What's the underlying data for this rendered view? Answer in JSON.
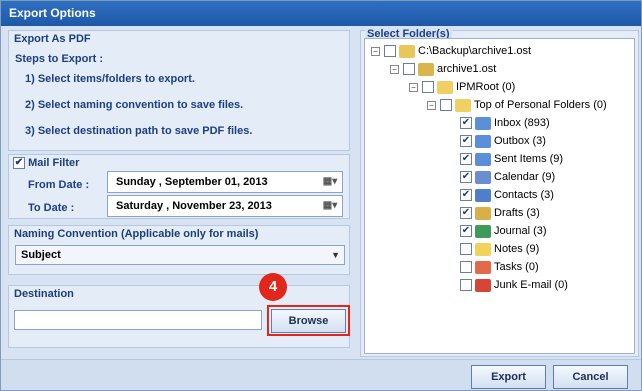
{
  "window": {
    "title": "Export Options"
  },
  "export_pdf": {
    "header": "Export As PDF",
    "steps_heading": "Steps to Export :",
    "steps": [
      "1) Select items/folders to export.",
      "2) Select naming convention to save files.",
      "3) Select destination path to save PDF files."
    ]
  },
  "mail_filter": {
    "label": "Mail Filter",
    "checked": true,
    "from_label": "From Date :",
    "from_value": "Sunday   , September 01, 2013",
    "to_label": "To Date :",
    "to_value": "Saturday  , November 23, 2013"
  },
  "naming": {
    "header": "Naming Convention (Applicable only for mails)",
    "selected": "Subject"
  },
  "destination": {
    "header": "Destination",
    "path_value": "",
    "browse_label": "Browse",
    "step_badge": "4"
  },
  "folders": {
    "header": "Select Folder(s)",
    "items": [
      {
        "label": "C:\\Backup\\archive1.ost",
        "checked": false,
        "icon": "folder-open-icon",
        "color": "#e8c658"
      },
      {
        "label": "archive1.ost",
        "checked": false,
        "icon": "pst-file-icon",
        "color": "#d9b64b"
      },
      {
        "label": "IPMRoot (0)",
        "checked": false,
        "icon": "folder-icon",
        "color": "#f0cf63"
      },
      {
        "label": "Top of Personal Folders (0)",
        "checked": false,
        "icon": "folder-icon",
        "color": "#f0cf63"
      },
      {
        "label": "Inbox (893)",
        "checked": true,
        "icon": "inbox-icon",
        "color": "#5b8fd8"
      },
      {
        "label": "Outbox (3)",
        "checked": true,
        "icon": "outbox-icon",
        "color": "#5b8fd8"
      },
      {
        "label": "Sent Items (9)",
        "checked": true,
        "icon": "sent-items-icon",
        "color": "#5b8fd8"
      },
      {
        "label": "Calendar (9)",
        "checked": true,
        "icon": "calendar-icon",
        "color": "#6a8ed0"
      },
      {
        "label": "Contacts (3)",
        "checked": true,
        "icon": "contacts-icon",
        "color": "#4f7fca"
      },
      {
        "label": "Drafts (3)",
        "checked": true,
        "icon": "drafts-icon",
        "color": "#d8b04a"
      },
      {
        "label": "Journal (3)",
        "checked": true,
        "icon": "journal-icon",
        "color": "#3e9b5a"
      },
      {
        "label": "Notes (9)",
        "checked": false,
        "icon": "notes-icon",
        "color": "#f2d35a"
      },
      {
        "label": "Tasks (0)",
        "checked": false,
        "icon": "tasks-icon",
        "color": "#e26a4a"
      },
      {
        "label": "Junk E-mail (0)",
        "checked": false,
        "icon": "junk-email-icon",
        "color": "#d64535"
      }
    ]
  },
  "footer": {
    "export_label": "Export",
    "cancel_label": "Cancel"
  }
}
